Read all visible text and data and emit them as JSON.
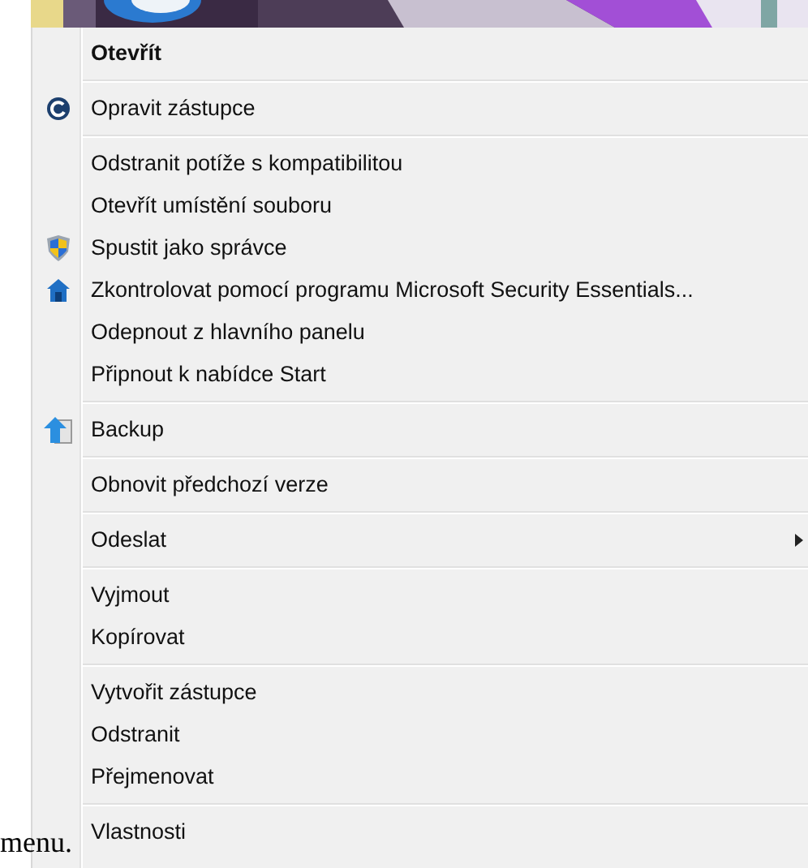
{
  "context_menu": {
    "groups": [
      {
        "items": [
          {
            "label": "Otevřít",
            "kind": "plain",
            "default": true,
            "submenu": false
          }
        ]
      },
      {
        "items": [
          {
            "label": "Opravit zástupce",
            "kind": "repair",
            "default": false,
            "submenu": false
          }
        ]
      },
      {
        "items": [
          {
            "label": "Odstranit potíže s kompatibilitou",
            "kind": "plain",
            "default": false,
            "submenu": false
          },
          {
            "label": "Otevřít umístění souboru",
            "kind": "plain",
            "default": false,
            "submenu": false
          },
          {
            "label": "Spustit jako správce",
            "kind": "admin",
            "default": false,
            "submenu": false
          },
          {
            "label": "Zkontrolovat pomocí programu Microsoft Security Essentials...",
            "kind": "scan",
            "default": false,
            "submenu": false
          },
          {
            "label": "Odepnout z hlavního panelu",
            "kind": "plain",
            "default": false,
            "submenu": false
          },
          {
            "label": "Připnout k nabídce Start",
            "kind": "plain",
            "default": false,
            "submenu": false
          }
        ]
      },
      {
        "items": [
          {
            "label": "Backup",
            "kind": "backup",
            "default": false,
            "submenu": false
          }
        ]
      },
      {
        "items": [
          {
            "label": "Obnovit předchozí verze",
            "kind": "plain",
            "default": false,
            "submenu": false
          }
        ]
      },
      {
        "items": [
          {
            "label": "Odeslat",
            "kind": "plain",
            "default": false,
            "submenu": true
          }
        ]
      },
      {
        "items": [
          {
            "label": "Vyjmout",
            "kind": "plain",
            "default": false,
            "submenu": false
          },
          {
            "label": "Kopírovat",
            "kind": "plain",
            "default": false,
            "submenu": false
          }
        ]
      },
      {
        "items": [
          {
            "label": "Vytvořit zástupce",
            "kind": "plain",
            "default": false,
            "submenu": false
          },
          {
            "label": "Odstranit",
            "kind": "plain",
            "default": false,
            "submenu": false
          },
          {
            "label": "Přejmenovat",
            "kind": "plain",
            "default": false,
            "submenu": false
          }
        ]
      },
      {
        "items": [
          {
            "label": "Vlastnosti",
            "kind": "plain",
            "default": false,
            "submenu": false
          }
        ]
      }
    ]
  },
  "overlay_text": "menu."
}
